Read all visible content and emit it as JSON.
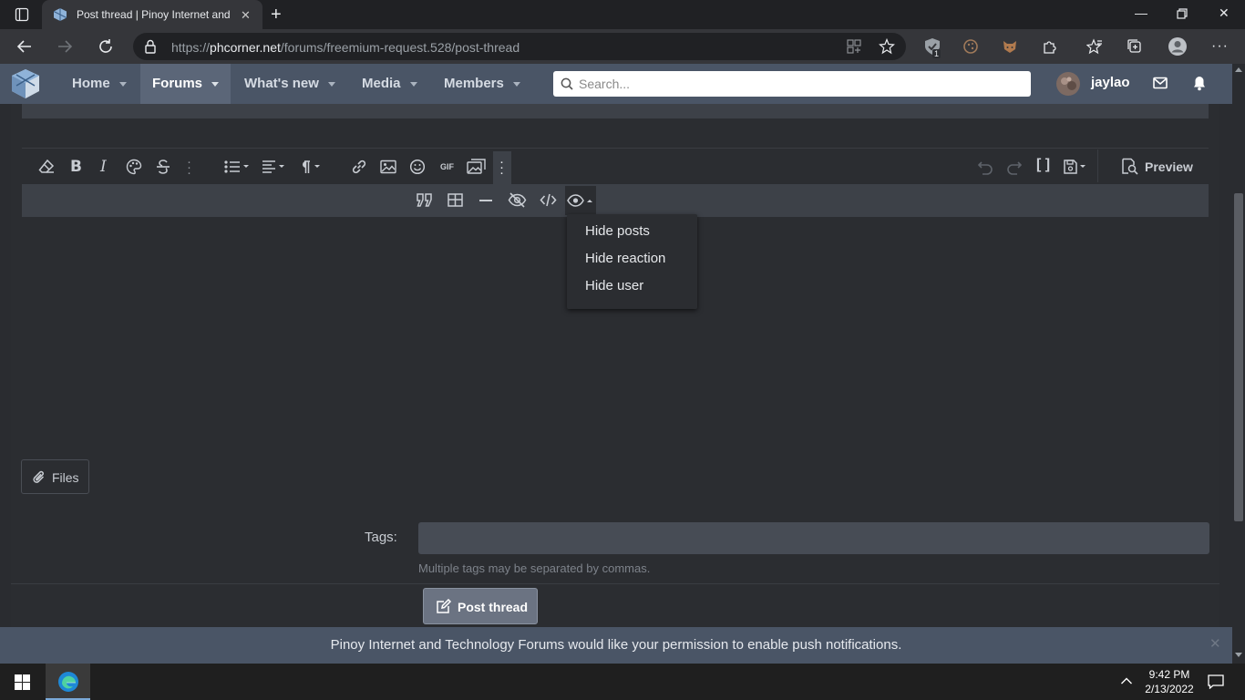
{
  "browser": {
    "tab_title": "Post thread | Pinoy Internet and",
    "tab_close": "✕",
    "url_prefix": "https://",
    "url_host": "phcorner.net",
    "url_path": "/forums/freemium-request.528/post-thread",
    "extension_badge": "1"
  },
  "site_nav": {
    "items": [
      {
        "label": "Home"
      },
      {
        "label": "Forums"
      },
      {
        "label": "What's new"
      },
      {
        "label": "Media"
      },
      {
        "label": "Members"
      }
    ],
    "active": "Forums",
    "search_placeholder": "Search...",
    "username": "jaylao"
  },
  "editor": {
    "preview_label": "Preview",
    "gif_label": "GIF",
    "hide_menu": {
      "items": [
        "Hide posts",
        "Hide reaction",
        "Hide user"
      ]
    }
  },
  "form": {
    "files_label": "Files",
    "tags_label": "Tags:",
    "tags_value": "",
    "tags_hint": "Multiple tags may be separated by commas.",
    "post_button": "Post thread"
  },
  "push_bar": {
    "message": "Pinoy Internet and Technology Forums would like your permission to enable push notifications.",
    "close": "✕"
  },
  "taskbar": {
    "time": "9:42 PM",
    "date": "2/13/2022"
  },
  "colors": {
    "nav_bg": "#4a5566",
    "nav_active": "#5b6678",
    "content_bg": "#2b2d31",
    "toolbar2_bg": "#3d4148",
    "button_bg": "#6b7382"
  }
}
